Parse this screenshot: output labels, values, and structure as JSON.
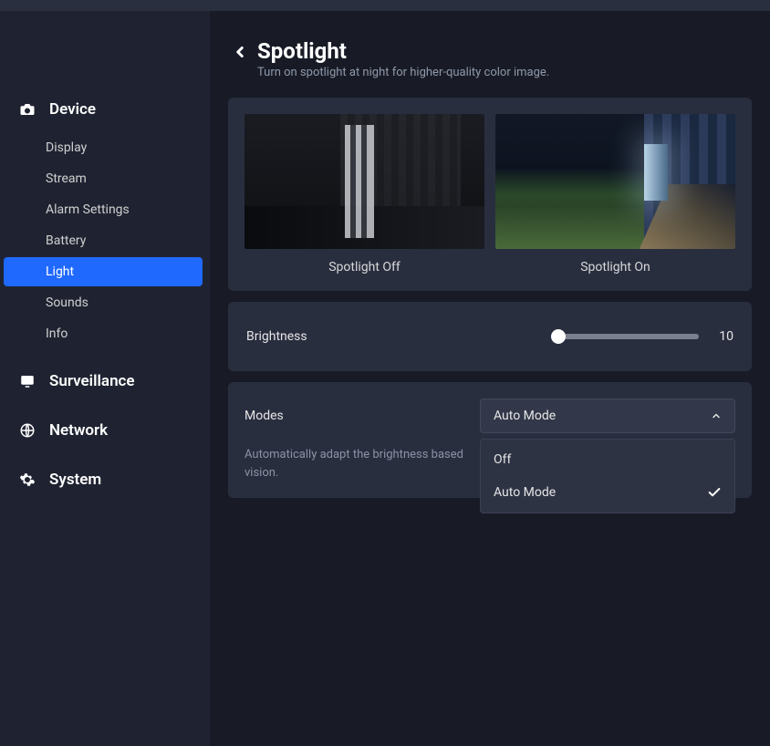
{
  "sidebar": {
    "sections": [
      {
        "label": "Device",
        "icon": "camera-icon",
        "expanded": true,
        "items": [
          {
            "label": "Display",
            "active": false
          },
          {
            "label": "Stream",
            "active": false
          },
          {
            "label": "Alarm Settings",
            "active": false
          },
          {
            "label": "Battery",
            "active": false
          },
          {
            "label": "Light",
            "active": true
          },
          {
            "label": "Sounds",
            "active": false
          },
          {
            "label": "Info",
            "active": false
          }
        ]
      },
      {
        "label": "Surveillance",
        "icon": "monitor-icon",
        "expanded": false,
        "items": []
      },
      {
        "label": "Network",
        "icon": "globe-icon",
        "expanded": false,
        "items": []
      },
      {
        "label": "System",
        "icon": "gear-icon",
        "expanded": false,
        "items": []
      }
    ]
  },
  "page": {
    "title": "Spotlight",
    "subtitle": "Turn on spotlight at night for higher-quality color image."
  },
  "previews": {
    "off_label": "Spotlight Off",
    "on_label": "Spotlight On"
  },
  "brightness": {
    "label": "Brightness",
    "value": "10"
  },
  "modes": {
    "label": "Modes",
    "selected": "Auto Mode",
    "options": [
      {
        "label": "Off",
        "checked": false
      },
      {
        "label": "Auto Mode",
        "checked": true
      }
    ],
    "description": "Automatically adapt the brightness based vision."
  }
}
